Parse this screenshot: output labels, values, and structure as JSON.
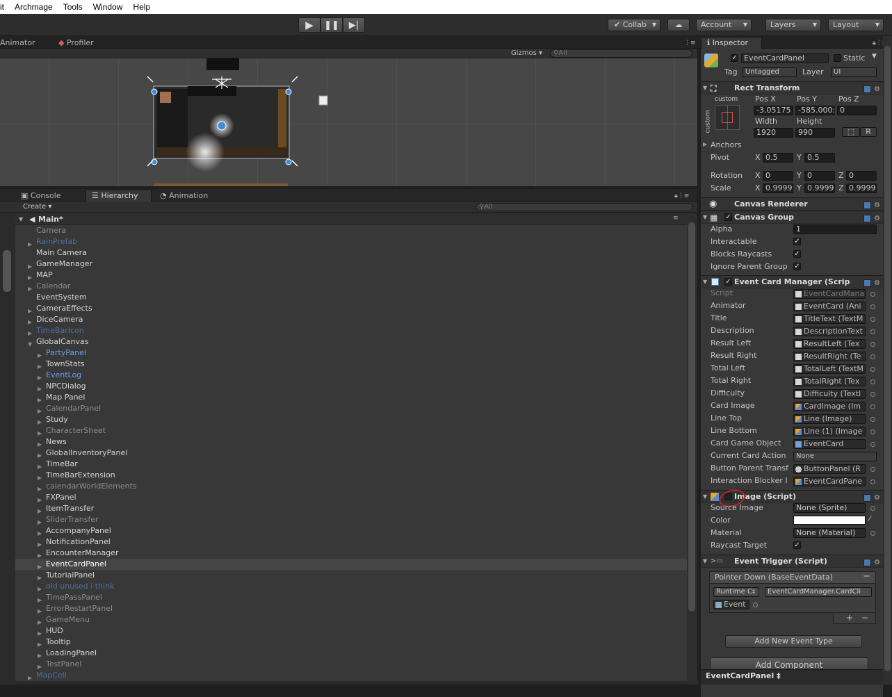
{
  "menu": [
    "it",
    "Archmage",
    "Tools",
    "Window",
    "Help"
  ],
  "toolbar": {
    "collab": "Collab",
    "account": "Account",
    "layers": "Layers",
    "layout": "Layout"
  },
  "top_tabs": {
    "animator": "Animator",
    "profiler": "Profiler",
    "gizmos": "Gizmos",
    "search_placeholder": "All"
  },
  "bottom_tabs": {
    "console": "Console",
    "hierarchy": "Hierarchy",
    "animation": "Animation",
    "create": "Create",
    "search_placeholder": "All"
  },
  "hierarchy": {
    "scene": "Main*",
    "items": [
      {
        "label": "Camera",
        "depth": 0,
        "arrow": false,
        "style": "gray"
      },
      {
        "label": "RainPrefab",
        "depth": 0,
        "arrow": true,
        "style": "prefab-dim"
      },
      {
        "label": "Main Camera",
        "depth": 0,
        "arrow": false,
        "style": "normal"
      },
      {
        "label": "GameManager",
        "depth": 0,
        "arrow": true,
        "style": "normal"
      },
      {
        "label": "MAP",
        "depth": 0,
        "arrow": true,
        "style": "normal"
      },
      {
        "label": "Calendar",
        "depth": 0,
        "arrow": true,
        "style": "gray"
      },
      {
        "label": "EventSystem",
        "depth": 0,
        "arrow": false,
        "style": "normal"
      },
      {
        "label": "CameraEffects",
        "depth": 0,
        "arrow": true,
        "style": "normal"
      },
      {
        "label": "DiceCamera",
        "depth": 0,
        "arrow": true,
        "style": "normal"
      },
      {
        "label": "TimeBarIcon",
        "depth": 0,
        "arrow": true,
        "style": "prefab-dim"
      },
      {
        "label": "GlobalCanvas",
        "depth": 0,
        "arrow": true,
        "expanded": true,
        "style": "normal"
      },
      {
        "label": "PartyPanel",
        "depth": 1,
        "arrow": true,
        "style": "prefab"
      },
      {
        "label": "TownStats",
        "depth": 1,
        "arrow": true,
        "style": "normal"
      },
      {
        "label": "EventLog",
        "depth": 1,
        "arrow": true,
        "style": "prefab"
      },
      {
        "label": "NPCDialog",
        "depth": 1,
        "arrow": true,
        "style": "normal"
      },
      {
        "label": "Map Panel",
        "depth": 1,
        "arrow": true,
        "style": "normal"
      },
      {
        "label": "CalendarPanel",
        "depth": 1,
        "arrow": true,
        "style": "gray"
      },
      {
        "label": "Study",
        "depth": 1,
        "arrow": true,
        "style": "normal"
      },
      {
        "label": "CharacterSheet",
        "depth": 1,
        "arrow": true,
        "style": "gray"
      },
      {
        "label": "News",
        "depth": 1,
        "arrow": true,
        "style": "normal"
      },
      {
        "label": "GlobalInventoryPanel",
        "depth": 1,
        "arrow": true,
        "style": "normal"
      },
      {
        "label": "TimeBar",
        "depth": 1,
        "arrow": true,
        "style": "normal"
      },
      {
        "label": "TimeBarExtension",
        "depth": 1,
        "arrow": true,
        "style": "normal"
      },
      {
        "label": "calendarWorldElements",
        "depth": 1,
        "arrow": true,
        "style": "gray"
      },
      {
        "label": "FXPanel",
        "depth": 1,
        "arrow": true,
        "style": "normal"
      },
      {
        "label": "ItemTransfer",
        "depth": 1,
        "arrow": true,
        "style": "normal"
      },
      {
        "label": "SliderTransfer",
        "depth": 1,
        "arrow": true,
        "style": "gray"
      },
      {
        "label": "AccompanyPanel",
        "depth": 1,
        "arrow": true,
        "style": "normal"
      },
      {
        "label": "NotificationPanel",
        "depth": 1,
        "arrow": true,
        "style": "normal"
      },
      {
        "label": "EncounterManager",
        "depth": 1,
        "arrow": true,
        "style": "normal"
      },
      {
        "label": "EventCardPanel",
        "depth": 1,
        "arrow": true,
        "style": "selected"
      },
      {
        "label": "TutorialPanel",
        "depth": 1,
        "arrow": true,
        "style": "normal"
      },
      {
        "label": "old unused i think",
        "depth": 1,
        "arrow": true,
        "style": "prefab-dim"
      },
      {
        "label": "TimePassPanel",
        "depth": 1,
        "arrow": true,
        "style": "gray"
      },
      {
        "label": "ErrorRestartPanel",
        "depth": 1,
        "arrow": true,
        "style": "gray"
      },
      {
        "label": "GameMenu",
        "depth": 1,
        "arrow": true,
        "style": "gray"
      },
      {
        "label": "HUD",
        "depth": 1,
        "arrow": true,
        "style": "normal"
      },
      {
        "label": "Tooltip",
        "depth": 1,
        "arrow": true,
        "style": "normal"
      },
      {
        "label": "LoadingPanel",
        "depth": 1,
        "arrow": true,
        "style": "normal"
      },
      {
        "label": "TestPanel",
        "depth": 1,
        "arrow": true,
        "style": "gray"
      },
      {
        "label": "MapCell",
        "depth": 0,
        "arrow": true,
        "style": "prefab-dim"
      }
    ]
  },
  "inspector": {
    "tab": "Inspector",
    "object_name": "EventCardPanel",
    "static": "Static",
    "tag_label": "Tag",
    "tag_value": "Untagged",
    "layer_label": "Layer",
    "layer_value": "UI",
    "rect": {
      "header": "Rect Transform",
      "custom": "custom",
      "custom_side": "custom",
      "posx_label": "Pos X",
      "posy_label": "Pos Y",
      "posz_label": "Pos Z",
      "posx": "-3.05175",
      "posy": "-585.000:",
      "posz": "0",
      "width_label": "Width",
      "height_label": "Height",
      "width": "1920",
      "height": "990",
      "r_button": "R",
      "anchors": "Anchors",
      "pivot": "Pivot",
      "pivot_x": "0.5",
      "pivot_y": "0.5",
      "rotation": "Rotation",
      "rot_x": "0",
      "rot_y": "0",
      "rot_z": "0",
      "scale": "Scale",
      "scale_x": "0.9999",
      "scale_y": "0.9999",
      "scale_z": "0.9999",
      "x": "X",
      "y": "Y",
      "z": "Z"
    },
    "canvas_renderer": "Canvas Renderer",
    "canvas_group": {
      "header": "Canvas Group",
      "alpha_label": "Alpha",
      "alpha": "1",
      "interactable": "Interactable",
      "blocks": "Blocks Raycasts",
      "ignore": "Ignore Parent Group"
    },
    "ecm": {
      "header": "Event Card Manager (Scrip",
      "rows": [
        {
          "label": "Script",
          "value": "EventCardMana",
          "icon": "script",
          "dim": true
        },
        {
          "label": "Animator",
          "value": "EventCard (Ani",
          "icon": "anim"
        },
        {
          "label": "Title",
          "value": "TitleText (TextM",
          "icon": "doc"
        },
        {
          "label": "Description",
          "value": "DescriptionText",
          "icon": "doc"
        },
        {
          "label": "Result Left",
          "value": "ResultLeft (Tex",
          "icon": "doc"
        },
        {
          "label": "Result Right",
          "value": "ResultRight (Te",
          "icon": "doc"
        },
        {
          "label": "Total Left",
          "value": "TotalLeft (TextM",
          "icon": "doc"
        },
        {
          "label": "Total Right",
          "value": "TotalRight (Tex",
          "icon": "doc"
        },
        {
          "label": "Difficulty",
          "value": "Difficulty (Textl",
          "icon": "doc"
        },
        {
          "label": "Card Image",
          "value": "CardImage (Im",
          "icon": "img"
        },
        {
          "label": "Line Top",
          "value": "Line (Image)",
          "icon": "img"
        },
        {
          "label": "Line Bottom",
          "value": "Line (1) (Image",
          "icon": "img"
        },
        {
          "label": "Card Game Object",
          "value": "EventCard",
          "icon": "go"
        },
        {
          "label": "Current Card Action",
          "value": "None",
          "icon": "dropdown"
        },
        {
          "label": "Button Parent Transf",
          "value": "ButtonPanel (R",
          "icon": "rt"
        },
        {
          "label": "Interaction Blocker I",
          "value": "EventCardPane",
          "icon": "img"
        }
      ]
    },
    "image": {
      "header": "Image (Script)",
      "source_label": "Source Image",
      "source": "None (Sprite)",
      "color_label": "Color",
      "material_label": "Material",
      "material": "None (Material)",
      "raycast": "Raycast Target"
    },
    "trigger": {
      "header": "Event Trigger (Script)",
      "event": "Pointer Down (BaseEventData)",
      "runtime": "Runtime C",
      "method": "EventCardManager.CardCli",
      "target": "Event",
      "add_event": "Add New Event Type"
    },
    "add_component": "Add Component",
    "footer": "EventCardPanel"
  },
  "colors": {
    "selected_row": "#454545",
    "prefab": "#6c9ef0",
    "annotation": "#e02020"
  }
}
